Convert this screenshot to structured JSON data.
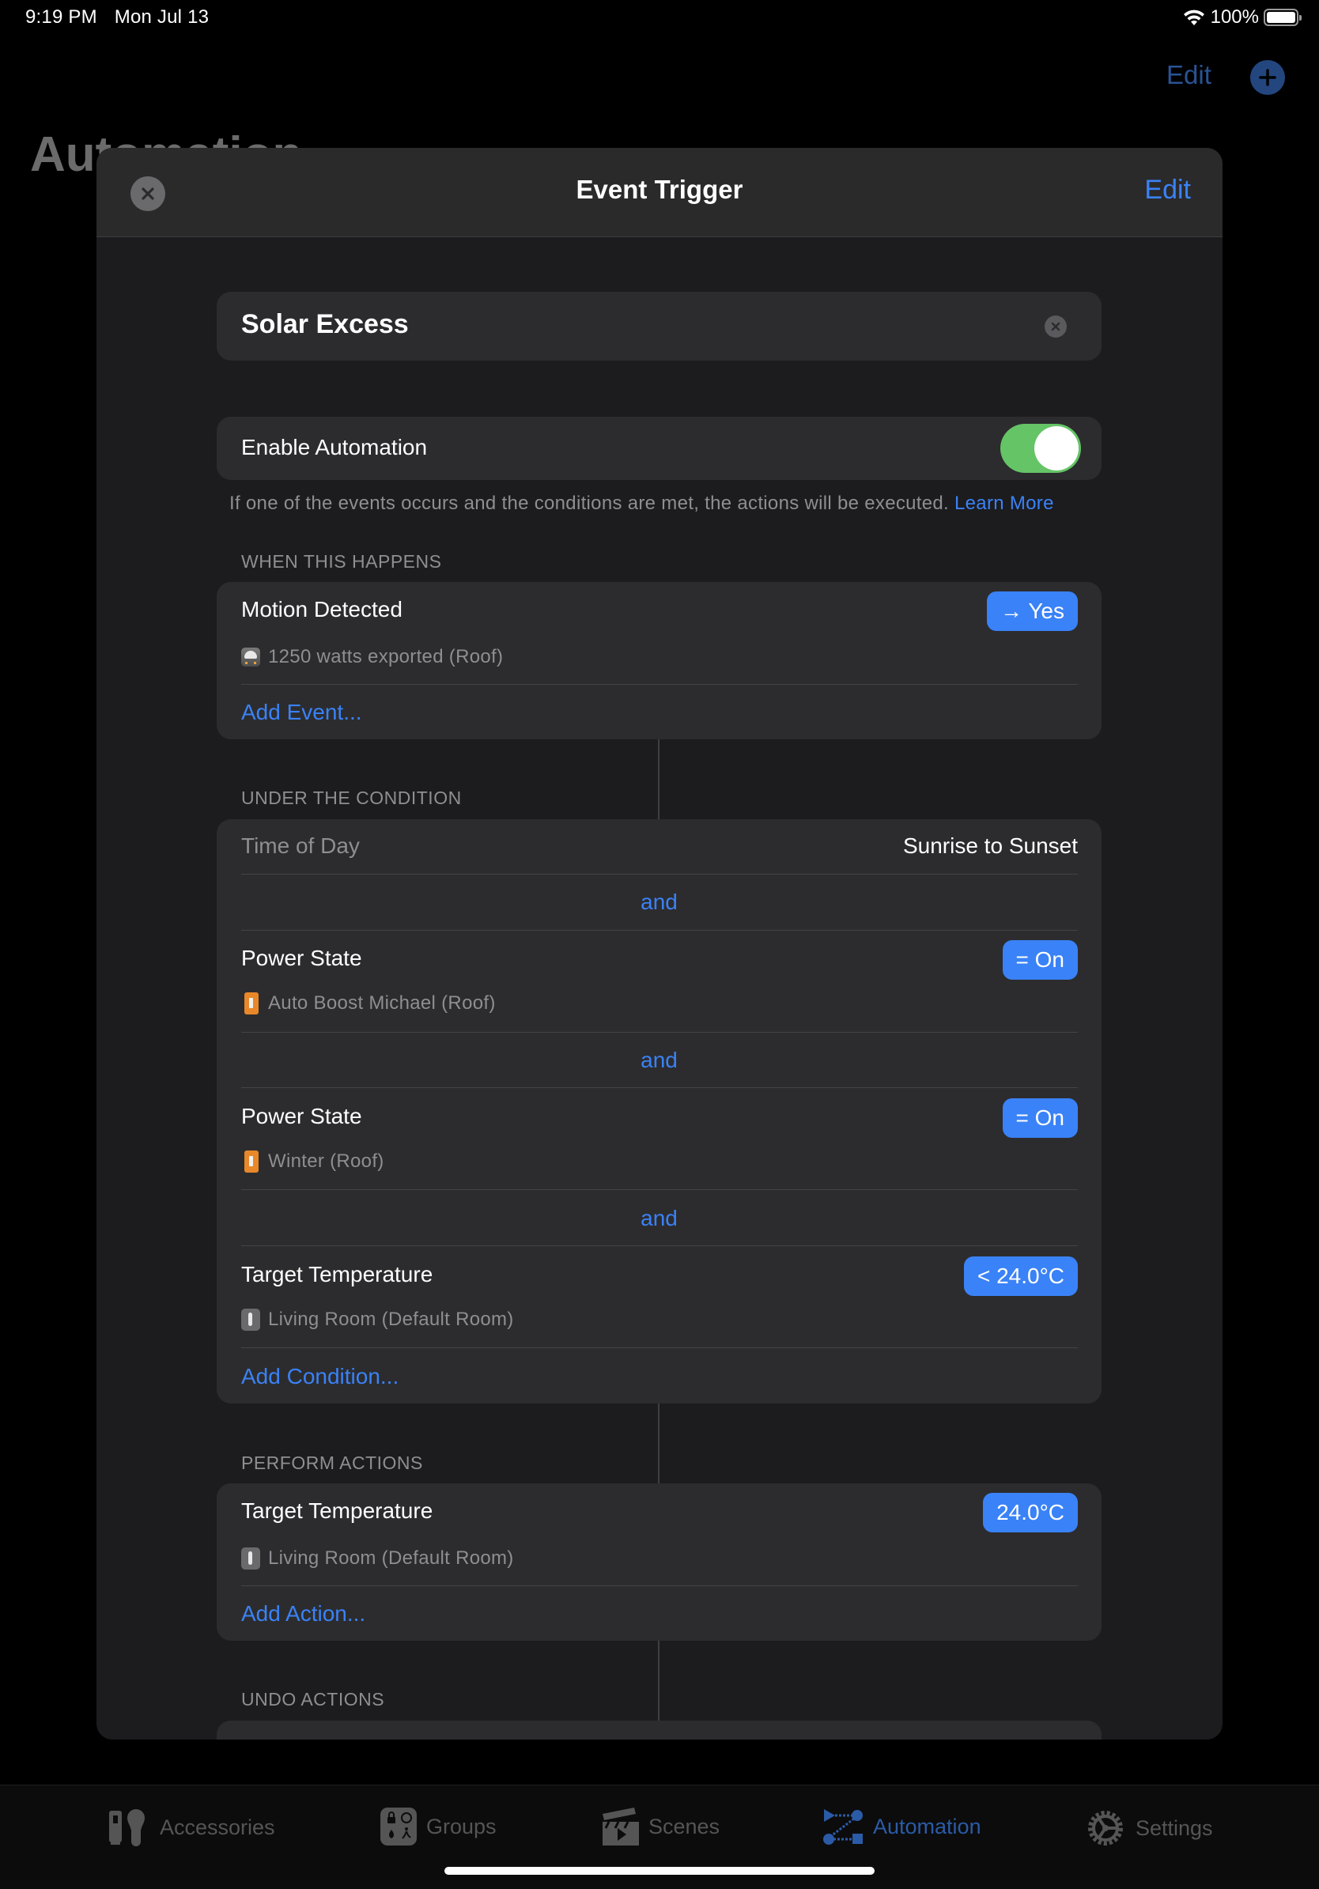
{
  "status_bar": {
    "time": "9:19 PM",
    "date": "Mon Jul 13",
    "battery_percent": "100%",
    "battery_level": 1.0
  },
  "background_page": {
    "title": "Automation",
    "edit_label": "Edit",
    "add_icon": "plus-circle-icon"
  },
  "modal": {
    "title": "Event Trigger",
    "close_icon": "close-icon",
    "edit_label": "Edit",
    "name_field": {
      "value": "Solar Excess",
      "clear_icon": "clear-icon"
    },
    "enable": {
      "label": "Enable Automation",
      "on": true
    },
    "footnote": {
      "text": "If one of the events occurs and the conditions are met, the actions will be executed.",
      "link": "Learn More"
    },
    "events": {
      "header": "WHEN THIS HAPPENS",
      "items": [
        {
          "title": "Motion Detected",
          "badge": "→ Yes",
          "icon": "power-meter-icon",
          "subtitle": "1250 watts exported (Roof)"
        }
      ],
      "add_label": "Add Event..."
    },
    "conditions": {
      "header": "UNDER THE CONDITION",
      "time_of_day": {
        "label": "Time of Day",
        "value": "Sunrise to Sunset"
      },
      "joiner": "and",
      "items": [
        {
          "title": "Power State",
          "badge": "= On",
          "icon": "switch-icon",
          "subtitle": "Auto Boost Michael (Roof)"
        },
        {
          "title": "Power State",
          "badge": "= On",
          "icon": "switch-icon",
          "subtitle": "Winter (Roof)"
        },
        {
          "title": "Target Temperature",
          "badge": "< 24.0°C",
          "icon": "thermostat-icon",
          "subtitle": "Living Room (Default Room)"
        }
      ],
      "add_label": "Add Condition..."
    },
    "actions": {
      "header": "PERFORM ACTIONS",
      "items": [
        {
          "title": "Target Temperature",
          "badge": "24.0°C",
          "icon": "thermostat-icon",
          "subtitle": "Living Room (Default Room)"
        }
      ],
      "add_label": "Add Action..."
    },
    "undo_actions": {
      "header": "UNDO ACTIONS"
    }
  },
  "tab_bar": {
    "active": "Automation",
    "tabs": [
      {
        "label": "Accessories",
        "icon": "accessories-icon"
      },
      {
        "label": "Groups",
        "icon": "groups-icon"
      },
      {
        "label": "Scenes",
        "icon": "scenes-icon"
      },
      {
        "label": "Automation",
        "icon": "automation-icon"
      },
      {
        "label": "Settings",
        "icon": "settings-icon"
      }
    ]
  },
  "colors": {
    "accent": "#3a82f7",
    "toggle_on": "#65c466",
    "card": "#2c2c2e",
    "modal_bg": "#1c1c1e",
    "secondary_text": "#8e8e93",
    "tab_active": "#2b5ba6",
    "tab_inactive": "#555555"
  }
}
